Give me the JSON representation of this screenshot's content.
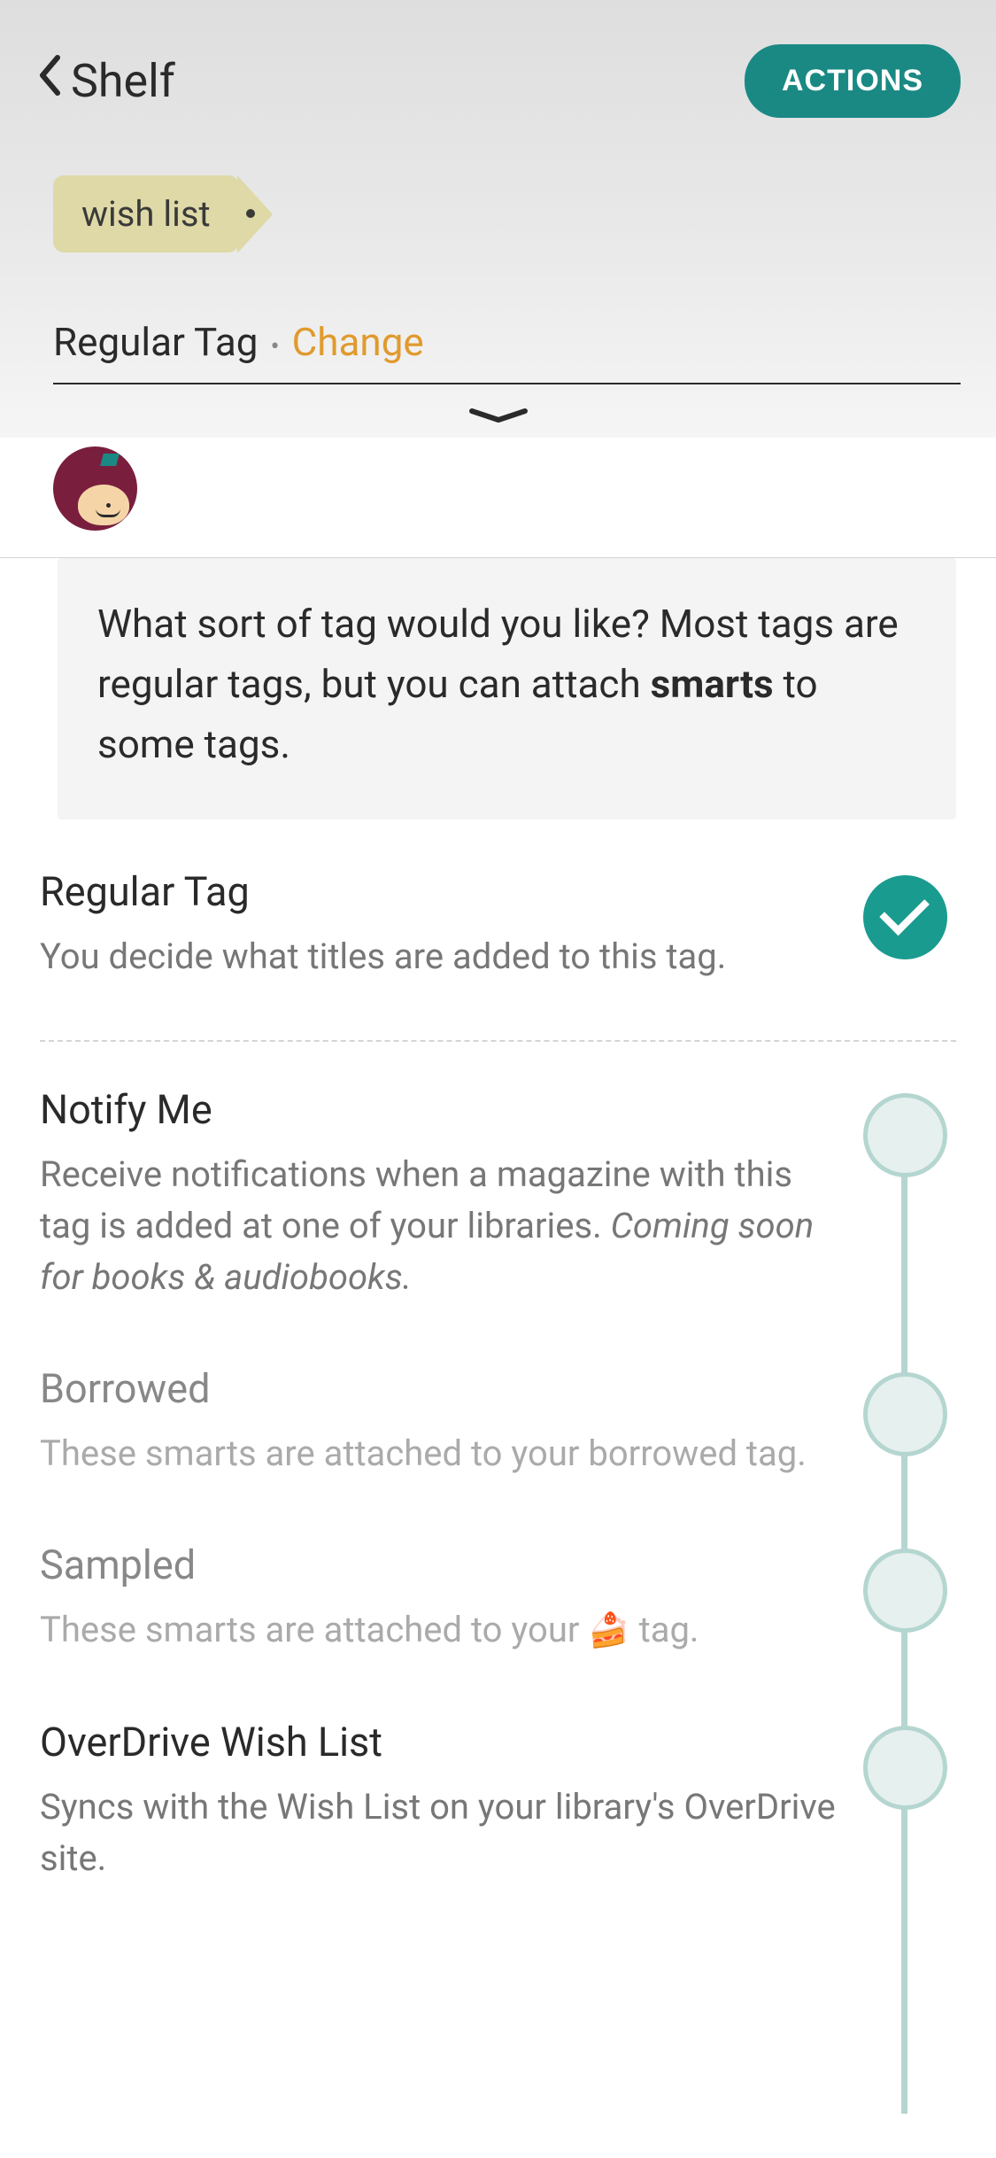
{
  "header": {
    "back_label": "Shelf",
    "actions_label": "ACTIONS"
  },
  "tag_chip": {
    "label": "wish list"
  },
  "tag_type": {
    "label": "Regular Tag",
    "change_label": "Change"
  },
  "info": {
    "text_before": "What sort of tag would you like? Most tags are regular tags, but you can attach ",
    "bold_word": "smarts",
    "text_after": " to some tags."
  },
  "options": {
    "regular": {
      "title": "Regular Tag",
      "desc": "You decide what titles are added to this tag."
    },
    "notify": {
      "title": "Notify Me",
      "desc_main": "Receive notifications when a magazine with this tag is added at one of your libraries.",
      "desc_italic": "Coming soon for books & audiobooks."
    },
    "borrowed": {
      "title": "Borrowed",
      "desc": "These smarts are attached to your borrowed tag."
    },
    "sampled": {
      "title": "Sampled",
      "desc_before": "These smarts are attached to your ",
      "desc_after": " tag."
    },
    "overdrive": {
      "title": "OverDrive Wish List",
      "desc": "Syncs with the Wish List on your library's OverDrive site."
    }
  }
}
